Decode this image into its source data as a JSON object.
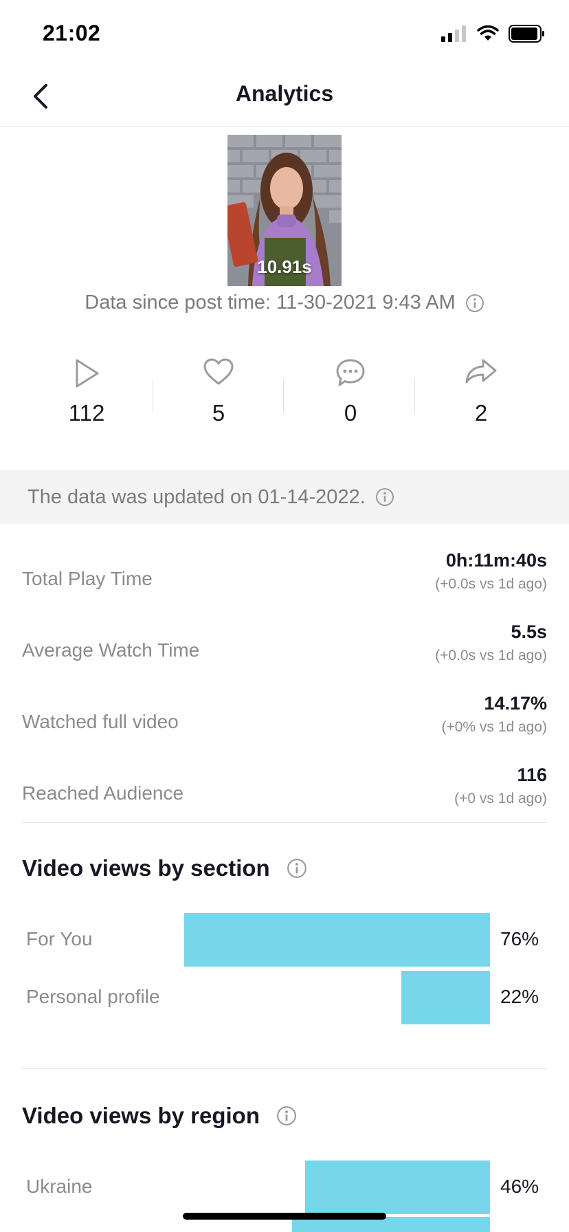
{
  "status_bar": {
    "time": "21:02"
  },
  "nav": {
    "title": "Analytics"
  },
  "video": {
    "duration": "10.91s"
  },
  "since": {
    "text": "Data since post time: 11-30-2021 9:43 AM"
  },
  "stats": [
    {
      "icon": "play-icon",
      "value": "112"
    },
    {
      "icon": "heart-icon",
      "value": "5"
    },
    {
      "icon": "comment-icon",
      "value": "0"
    },
    {
      "icon": "share-icon",
      "value": "2"
    }
  ],
  "updated": {
    "text": "The data was updated on 01-14-2022."
  },
  "metrics": [
    {
      "label": "Total Play Time",
      "value": "0h:11m:40s",
      "delta": "(+0.0s vs 1d ago)"
    },
    {
      "label": "Average Watch Time",
      "value": "5.5s",
      "delta": "(+0.0s vs 1d ago)"
    },
    {
      "label": "Watched full video",
      "value": "14.17%",
      "delta": "(+0% vs 1d ago)"
    },
    {
      "label": "Reached Audience",
      "value": "116",
      "delta": "(+0 vs 1d ago)"
    }
  ],
  "section_views": {
    "title": "Video views by section",
    "rows": [
      {
        "label": "For You",
        "pct": "76%",
        "percent": 76
      },
      {
        "label": "Personal profile",
        "pct": "22%",
        "percent": 22
      }
    ]
  },
  "region_views": {
    "title": "Video views by region",
    "rows": [
      {
        "label": "Ukraine",
        "pct": "46%",
        "percent": 46
      }
    ]
  },
  "colors": {
    "bar": "#77d7ea",
    "text": "#161823",
    "muted": "#8a8b91"
  }
}
